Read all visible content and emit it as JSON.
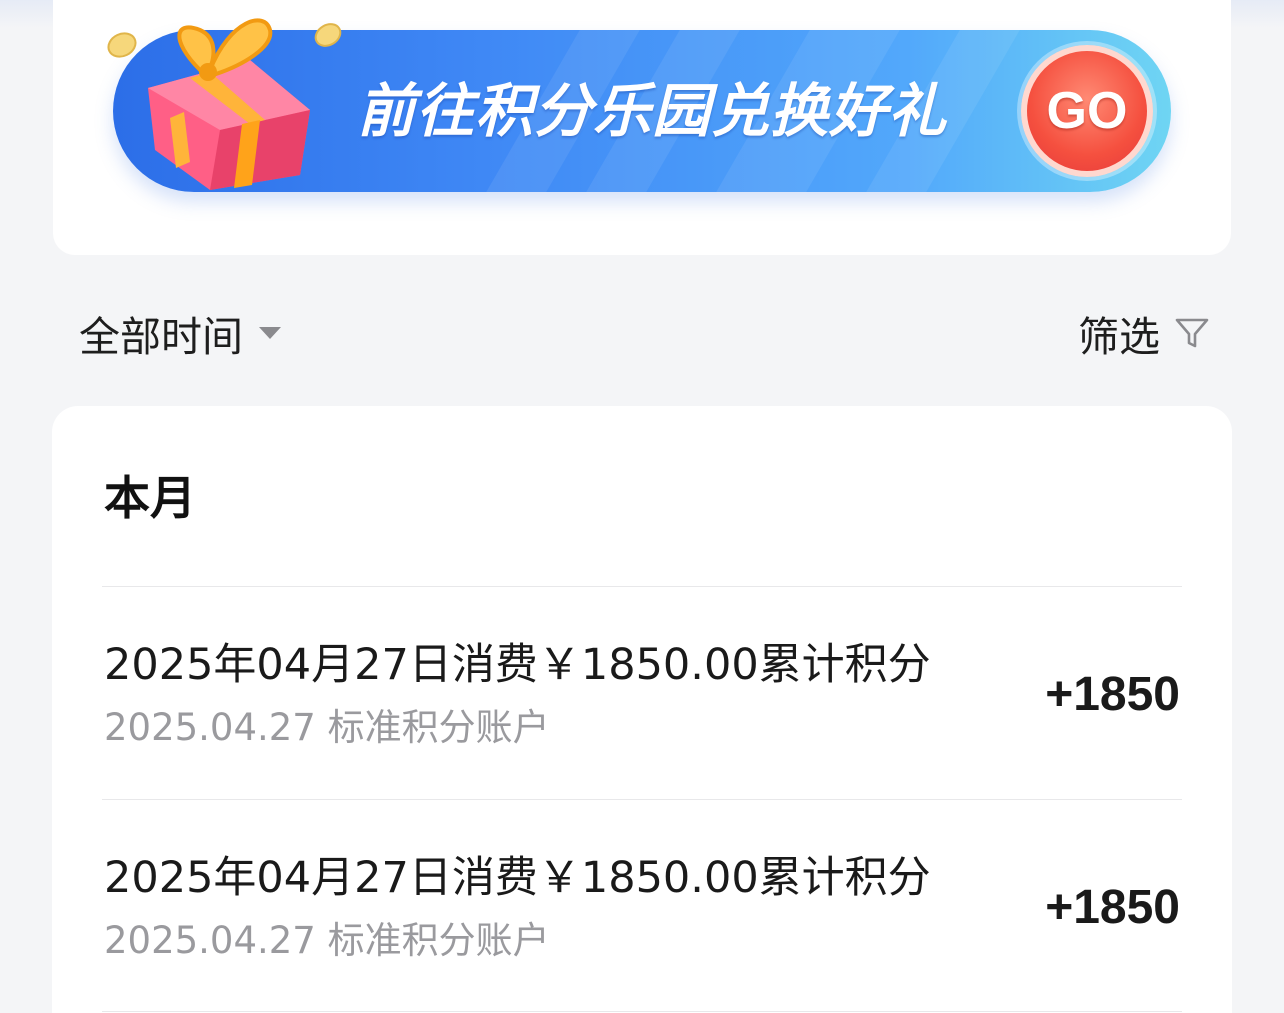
{
  "banner": {
    "title": "前往积分乐园兑换好礼",
    "go_label": "GO",
    "colors": {
      "start": "#2c6ee8",
      "end": "#6fd5f3",
      "go": "#f5503f"
    }
  },
  "filters": {
    "time_label": "全部时间",
    "filter_label": "筛选"
  },
  "section": {
    "title": "本月"
  },
  "records": [
    {
      "title": "2025年04月27日消费￥1850.00累计积分",
      "subtitle": "2025.04.27 标准积分账户",
      "points": "+1850"
    },
    {
      "title": "2025年04月27日消费￥1850.00累计积分",
      "subtitle": "2025.04.27 标准积分账户",
      "points": "+1850"
    }
  ]
}
